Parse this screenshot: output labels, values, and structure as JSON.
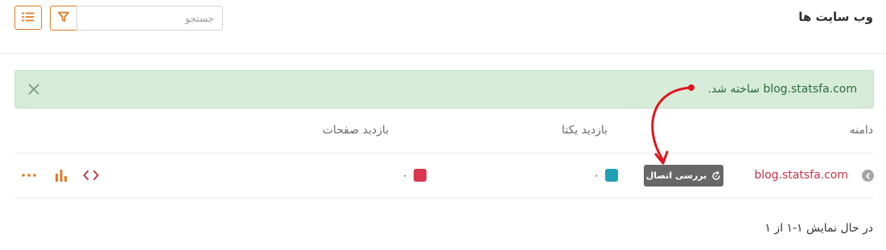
{
  "header": {
    "title": "وب سایت ها",
    "search_placeholder": "جستجو",
    "filter_icon": "filter-icon",
    "list_icon": "list-icon"
  },
  "alert": {
    "message": "blog.statsfa.com ساخته شد.",
    "close_icon": "close-icon"
  },
  "table": {
    "columns": {
      "domain": "دامنه",
      "unique_visits": "بازدید یکتا",
      "page_views": "بازدید صفحات"
    },
    "rows": [
      {
        "domain": "blog.statsfa.com",
        "check_connection_label": "بررسی اتصال",
        "unique_visits": "۰",
        "page_views": "۰",
        "unique_color": "#1ea0b4",
        "page_views_color": "#d9374f"
      }
    ]
  },
  "footer": {
    "pagination_text": "در حال نمایش ۱-۱ از ۱"
  },
  "colors": {
    "accent": "#e07b22",
    "alert_bg": "#d6ecd9",
    "alert_text": "#2d6a36",
    "link": "#c9304a",
    "annotation_arrow": "#e0141e"
  }
}
